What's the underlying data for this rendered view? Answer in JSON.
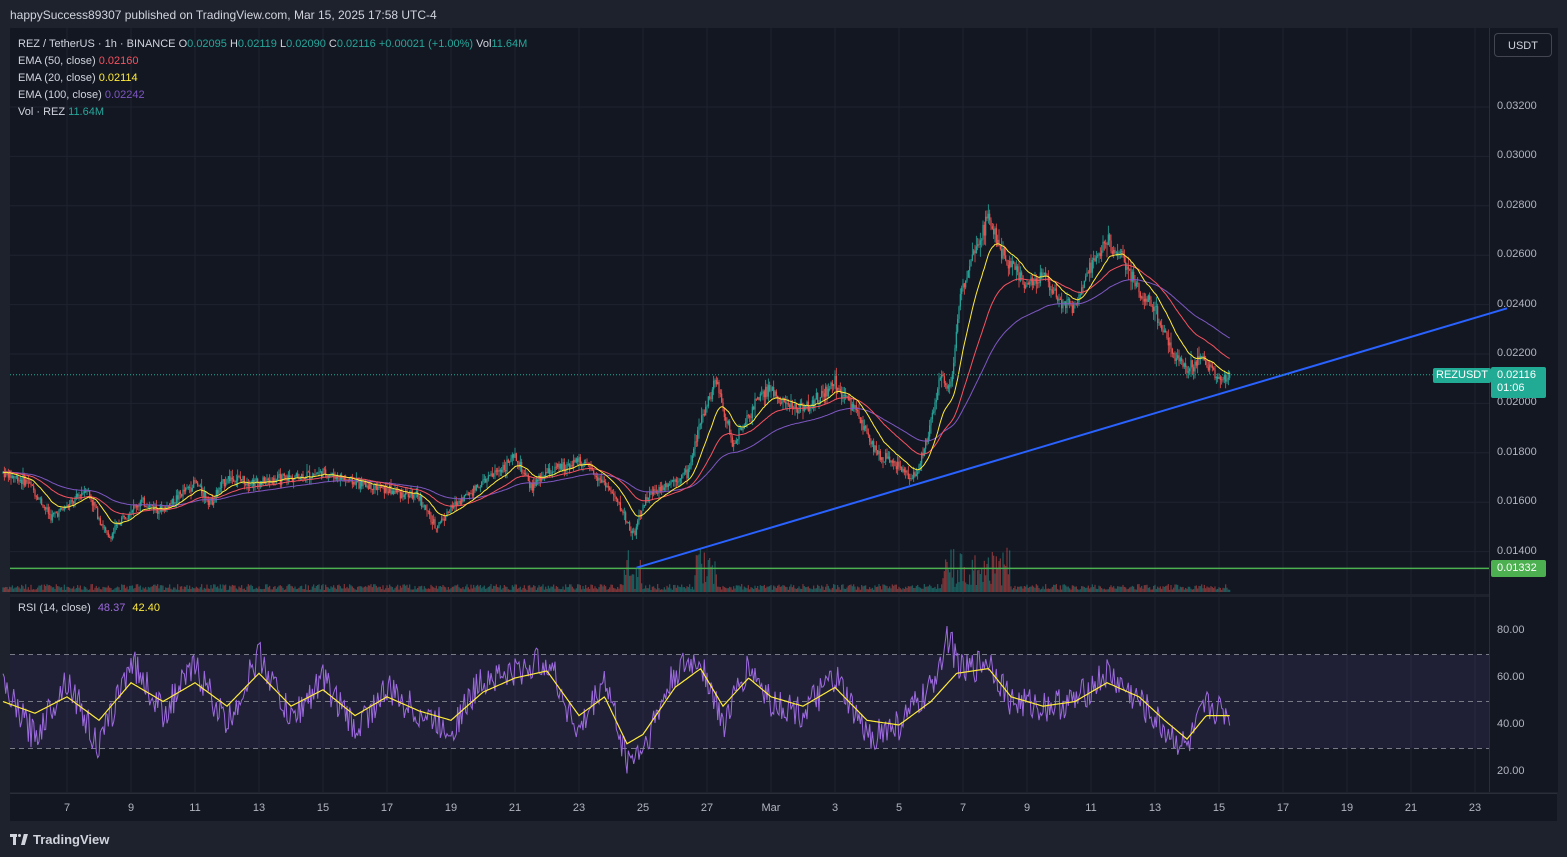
{
  "header": {
    "publish_text": "happySuccess89307 published on TradingView.com, Mar 15, 2025 17:58 UTC-4"
  },
  "legend": {
    "symbol": "REZ / TetherUS · 1h · BINANCE",
    "o_label": "O",
    "o_value": "0.02095",
    "h_label": "H",
    "h_value": "0.02119",
    "l_label": "L",
    "l_value": "0.02090",
    "c_label": "C",
    "c_value": "0.02116",
    "change": "+0.00021 (+1.00%)",
    "vol_label": "Vol",
    "vol_value": "11.64M",
    "ema50_label": "EMA (50, close)",
    "ema50_value": "0.02160",
    "ema20_label": "EMA (20, close)",
    "ema20_value": "0.02114",
    "ema100_label": "EMA (100, close)",
    "ema100_value": "0.02242",
    "vol_ind_label": "Vol · REZ",
    "vol_ind_value": "11.64M"
  },
  "rsi_legend": {
    "label": "RSI (14, close)",
    "rsi_value": "48.37",
    "ma_value": "42.40"
  },
  "currency_button": "USDT",
  "price_tag": {
    "symbol": "REZUSDT",
    "price": "0.02116",
    "countdown": "01:06"
  },
  "hline_tag": "0.01332",
  "footer": {
    "brand": "TradingView"
  },
  "colors": {
    "ema50": "#f7525f",
    "ema20": "#ffeb3b",
    "ema100": "#7e57c2",
    "trendline": "#2962ff",
    "support": "#4caf50",
    "rsi": "#9c6ade",
    "rsi_ma": "#ffeb3b",
    "up": "#26a69a",
    "down": "#ef5350"
  },
  "chart_data": [
    {
      "type": "candlestick",
      "x_tick_labels": [
        "7",
        "9",
        "11",
        "13",
        "15",
        "17",
        "19",
        "21",
        "23",
        "25",
        "27",
        "Mar",
        "3",
        "5",
        "7",
        "9",
        "11",
        "13",
        "15",
        "17",
        "19",
        "21",
        "23"
      ],
      "x_tick_days": [
        7,
        9,
        11,
        13,
        15,
        17,
        19,
        21,
        23,
        25,
        27,
        29,
        31,
        33,
        35,
        37,
        39,
        41,
        43,
        45,
        47,
        49,
        51
      ],
      "price_ticks": [
        "0.03200",
        "0.03000",
        "0.02800",
        "0.02600",
        "0.02400",
        "0.02200",
        "0.02000",
        "0.01800",
        "0.01600",
        "0.01400"
      ],
      "ylim": [
        0.0128,
        0.0338
      ],
      "close_path": [
        [
          5.0,
          0.0172
        ],
        [
          5.8,
          0.0168
        ],
        [
          6.5,
          0.0154
        ],
        [
          7.2,
          0.016
        ],
        [
          7.6,
          0.0166
        ],
        [
          8.3,
          0.0145
        ],
        [
          8.8,
          0.0155
        ],
        [
          9.3,
          0.016
        ],
        [
          10.0,
          0.0157
        ],
        [
          11.0,
          0.0168
        ],
        [
          11.5,
          0.016
        ],
        [
          12.0,
          0.017
        ],
        [
          13.0,
          0.0168
        ],
        [
          14.0,
          0.017
        ],
        [
          15.0,
          0.0172
        ],
        [
          16.0,
          0.0168
        ],
        [
          17.0,
          0.0165
        ],
        [
          18.0,
          0.0162
        ],
        [
          18.5,
          0.015
        ],
        [
          19.2,
          0.016
        ],
        [
          20.0,
          0.0168
        ],
        [
          21.0,
          0.0178
        ],
        [
          21.5,
          0.0166
        ],
        [
          22.0,
          0.0172
        ],
        [
          23.0,
          0.0177
        ],
        [
          23.8,
          0.0168
        ],
        [
          24.3,
          0.0158
        ],
        [
          24.7,
          0.0146
        ],
        [
          25.1,
          0.0162
        ],
        [
          25.8,
          0.0168
        ],
        [
          26.4,
          0.0172
        ],
        [
          26.8,
          0.0193
        ],
        [
          27.3,
          0.021
        ],
        [
          27.8,
          0.0183
        ],
        [
          28.5,
          0.02
        ],
        [
          29.0,
          0.0206
        ],
        [
          29.6,
          0.0198
        ],
        [
          30.3,
          0.02
        ],
        [
          31.0,
          0.0208
        ],
        [
          31.6,
          0.0198
        ],
        [
          32.3,
          0.018
        ],
        [
          33.0,
          0.0174
        ],
        [
          33.5,
          0.017
        ],
        [
          33.9,
          0.0186
        ],
        [
          34.3,
          0.0212
        ],
        [
          34.6,
          0.0205
        ],
        [
          34.9,
          0.0242
        ],
        [
          35.3,
          0.0262
        ],
        [
          35.8,
          0.0275
        ],
        [
          36.3,
          0.0258
        ],
        [
          37.0,
          0.0248
        ],
        [
          37.5,
          0.0252
        ],
        [
          38.0,
          0.0242
        ],
        [
          38.5,
          0.0238
        ],
        [
          39.0,
          0.0256
        ],
        [
          39.5,
          0.0266
        ],
        [
          40.0,
          0.0258
        ],
        [
          40.5,
          0.0246
        ],
        [
          41.0,
          0.0238
        ],
        [
          41.5,
          0.0222
        ],
        [
          42.0,
          0.0214
        ],
        [
          42.5,
          0.0218
        ],
        [
          43.0,
          0.021
        ],
        [
          43.3,
          0.0212
        ]
      ],
      "trendline": {
        "start": [
          24.8,
          0.01335
        ],
        "end": [
          52.0,
          0.02385
        ]
      },
      "support_level": 0.01332,
      "last_price": 0.02116
    },
    {
      "type": "line",
      "indicator": "RSI",
      "ylim": [
        15,
        90
      ],
      "tick_labels": [
        "80.00",
        "60.00",
        "40.00",
        "20.00"
      ],
      "bands": [
        70,
        50,
        30
      ],
      "rsi_path": [
        [
          5,
          55
        ],
        [
          6,
          35
        ],
        [
          7,
          60
        ],
        [
          8,
          30
        ],
        [
          9,
          68
        ],
        [
          10,
          45
        ],
        [
          11,
          65
        ],
        [
          12,
          40
        ],
        [
          13,
          70
        ],
        [
          14,
          42
        ],
        [
          15,
          60
        ],
        [
          16,
          38
        ],
        [
          17,
          55
        ],
        [
          18,
          45
        ],
        [
          19,
          38
        ],
        [
          20,
          60
        ],
        [
          21,
          62
        ],
        [
          22,
          68
        ],
        [
          23,
          36
        ],
        [
          23.8,
          60
        ],
        [
          24.5,
          25
        ],
        [
          25,
          30
        ],
        [
          26,
          62
        ],
        [
          26.8,
          68
        ],
        [
          27.5,
          40
        ],
        [
          28.3,
          65
        ],
        [
          29,
          50
        ],
        [
          30,
          45
        ],
        [
          31,
          60
        ],
        [
          32,
          35
        ],
        [
          33,
          40
        ],
        [
          34,
          55
        ],
        [
          34.5,
          78
        ],
        [
          35,
          62
        ],
        [
          35.8,
          68
        ],
        [
          36.5,
          50
        ],
        [
          37.5,
          48
        ],
        [
          38.5,
          50
        ],
        [
          39.5,
          62
        ],
        [
          40.5,
          50
        ],
        [
          41.3,
          38
        ],
        [
          42,
          30
        ],
        [
          42.6,
          48
        ],
        [
          43.3,
          45
        ]
      ],
      "rsi_ma_path": [
        [
          5,
          50
        ],
        [
          6,
          45
        ],
        [
          7,
          52
        ],
        [
          8,
          42
        ],
        [
          9,
          58
        ],
        [
          10,
          50
        ],
        [
          11,
          58
        ],
        [
          12,
          48
        ],
        [
          13,
          62
        ],
        [
          14,
          48
        ],
        [
          15,
          55
        ],
        [
          16,
          44
        ],
        [
          17,
          52
        ],
        [
          18,
          46
        ],
        [
          19,
          42
        ],
        [
          20,
          54
        ],
        [
          21,
          60
        ],
        [
          22,
          63
        ],
        [
          23,
          44
        ],
        [
          23.8,
          52
        ],
        [
          24.5,
          32
        ],
        [
          25,
          36
        ],
        [
          26,
          56
        ],
        [
          26.8,
          64
        ],
        [
          27.5,
          48
        ],
        [
          28.3,
          60
        ],
        [
          29,
          52
        ],
        [
          30,
          48
        ],
        [
          31,
          56
        ],
        [
          32,
          42
        ],
        [
          33,
          40
        ],
        [
          34,
          50
        ],
        [
          34.8,
          62
        ],
        [
          35.8,
          64
        ],
        [
          36.5,
          52
        ],
        [
          37.5,
          48
        ],
        [
          38.5,
          50
        ],
        [
          39.5,
          58
        ],
        [
          40.5,
          52
        ],
        [
          41.3,
          42
        ],
        [
          42,
          34
        ],
        [
          42.6,
          44
        ],
        [
          43.3,
          44
        ]
      ]
    }
  ]
}
